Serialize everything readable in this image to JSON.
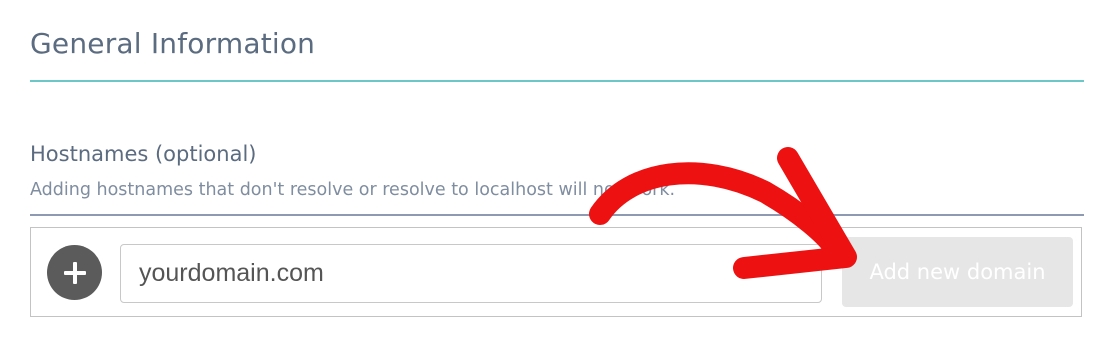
{
  "section": {
    "title": "General Information"
  },
  "hostnames": {
    "label": "Hostnames (optional)",
    "help_text": "Adding hostnames that don't resolve or resolve to localhost will not work.",
    "input_placeholder": "yourdomain.com",
    "add_button_label": "Add new domain"
  },
  "icons": {
    "add": "plus-circle-icon",
    "annotation": "red-arrow-annotation"
  },
  "colors": {
    "title_text": "#5b6b80",
    "section_rule": "#6cc8c8",
    "field_rule": "#8e9ab2",
    "add_icon_bg": "#5b5b5b",
    "button_disabled_bg": "#e6e6e6",
    "annotation_red": "#ee1111"
  }
}
